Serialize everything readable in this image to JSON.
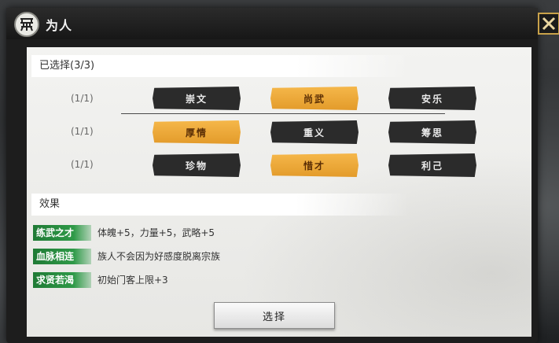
{
  "title": "为人",
  "selected_header": "已选择(3/3)",
  "effects_header": "效果",
  "rows": [
    {
      "count": "(1/1)",
      "options": [
        {
          "label": "崇文",
          "selected": false
        },
        {
          "label": "尚武",
          "selected": true
        },
        {
          "label": "安乐",
          "selected": false
        }
      ]
    },
    {
      "count": "(1/1)",
      "options": [
        {
          "label": "厚情",
          "selected": true
        },
        {
          "label": "重义",
          "selected": false
        },
        {
          "label": "筹思",
          "selected": false
        }
      ]
    },
    {
      "count": "(1/1)",
      "options": [
        {
          "label": "珍物",
          "selected": false
        },
        {
          "label": "惜才",
          "selected": true
        },
        {
          "label": "利己",
          "selected": false
        }
      ]
    }
  ],
  "effects": [
    {
      "tag": "练武之才",
      "text": "体魄+5，力量+5，武略+5"
    },
    {
      "tag": "血脉相连",
      "text": "族人不会因为好感度脱离宗族"
    },
    {
      "tag": "求贤若渴",
      "text": "初始门客上限+3"
    }
  ],
  "select_button": "选择",
  "colors": {
    "selected": "#e39b2a",
    "unselected": "#2b2b2b",
    "effect_tag": "#2f9a48",
    "close_border": "#c9a24a"
  },
  "icons": {
    "title": "clan-emblem-icon",
    "close": "close-icon"
  }
}
